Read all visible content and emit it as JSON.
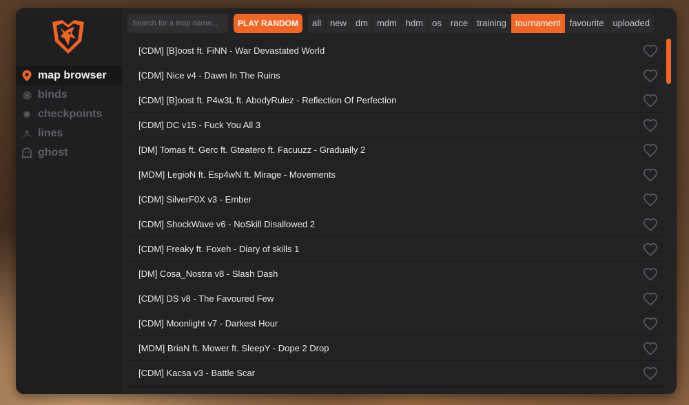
{
  "sidebar": {
    "nav": [
      {
        "label": "map browser",
        "icon": "map-pin-icon",
        "active": true
      },
      {
        "label": "binds",
        "icon": "gear-icon",
        "active": false
      },
      {
        "label": "checkpoints",
        "icon": "dot-icon",
        "active": false
      },
      {
        "label": "lines",
        "icon": "route-icon",
        "active": false
      },
      {
        "label": "ghost",
        "icon": "ghost-icon",
        "active": false
      }
    ]
  },
  "topbar": {
    "search_placeholder": "Search for a map name...",
    "play_random_label": "PLAY RANDOM",
    "filters": [
      {
        "label": "all",
        "active": false
      },
      {
        "label": "new",
        "active": false
      },
      {
        "label": "dm",
        "active": false
      },
      {
        "label": "mdm",
        "active": false
      },
      {
        "label": "hdm",
        "active": false
      },
      {
        "label": "os",
        "active": false
      },
      {
        "label": "race",
        "active": false
      },
      {
        "label": "training",
        "active": false
      },
      {
        "label": "tournament",
        "active": true
      },
      {
        "label": "favourite",
        "active": false
      },
      {
        "label": "uploaded",
        "active": false
      }
    ]
  },
  "maps": [
    "[CDM] [B]oost ft. FiNN - War Devastated World",
    "[CDM] Nice v4 - Dawn In The Ruins",
    "[CDM] [B]oost ft. P4w3L ft. AbodyRulez - Reflection Of Perfection",
    "[CDM] DC v15 - Fuck You All 3",
    "[DM] Tomas ft. Gerc ft. Gteatero ft. Facuuzz - Gradually 2",
    "[MDM] LegioN ft. Esp4wN ft. Mirage - Movements",
    "[CDM] SilverF0X v3 - Ember",
    "[CDM] ShockWave v6 - NoSkill Disallowed 2",
    "[CDM] Freaky ft. Foxeh - Diary of skills 1",
    "[DM] Cosa_Nostra v8 - Slash Dash",
    "[CDM] DS v8 - The Favoured Few",
    "[CDM] Moonlight v7 - Darkest Hour",
    "[MDM] BriaN ft. Mower ft. SleepY - Dope 2 Drop",
    "[CDM] Kacsa v3 - Battle Scar"
  ],
  "colors": {
    "accent": "#f26522",
    "panel": "#1d1d1f",
    "row": "#222224"
  },
  "scroll_position": 0
}
